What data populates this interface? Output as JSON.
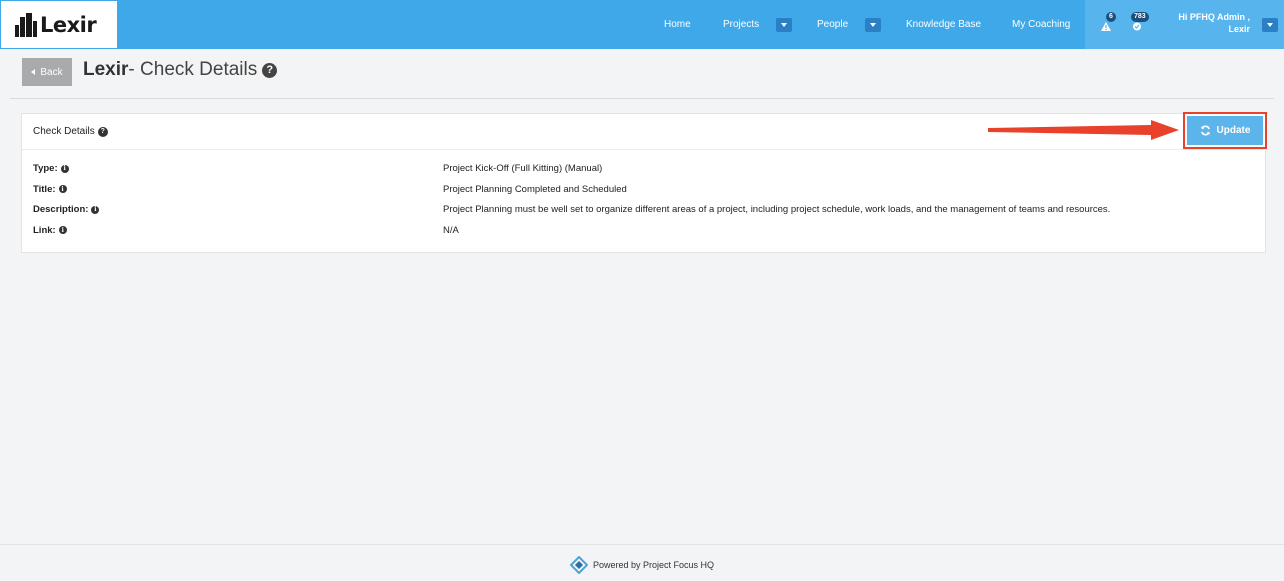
{
  "app": {
    "logo_text": "Lexir"
  },
  "nav": {
    "home": "Home",
    "projects": "Projects",
    "people": "People",
    "knowledge_base": "Knowledge Base",
    "my_coaching": "My Coaching",
    "alerts_count": "6",
    "notifications_count": "783",
    "user_greeting": "Hi PFHQ Admin ,",
    "user_org": "Lexir"
  },
  "header": {
    "back_label": "Back",
    "title_bold": "Lexir",
    "title_rest": "- Check Details"
  },
  "panel": {
    "heading": "Check Details",
    "update_label": "Update",
    "rows": [
      {
        "label": "Type:",
        "value": "Project Kick-Off (Full Kitting) (Manual)"
      },
      {
        "label": "Title:",
        "value": "Project Planning Completed and Scheduled"
      },
      {
        "label": "Description:",
        "value": "Project Planning must be well set to organize different areas of a project, including project schedule, work loads, and the management of teams and resources."
      },
      {
        "label": "Link:",
        "value": "N/A"
      }
    ]
  },
  "footer": {
    "text": "Powered by Project Focus HQ"
  },
  "colors": {
    "topbar": "#3fa8e8",
    "accent": "#5bb5ea",
    "highlight": "#e8412c"
  },
  "icons": [
    "building-logo-icon",
    "help-icon",
    "info-icon",
    "refresh-icon",
    "warning-icon",
    "bell-icon",
    "pfhq-logo-icon"
  ]
}
